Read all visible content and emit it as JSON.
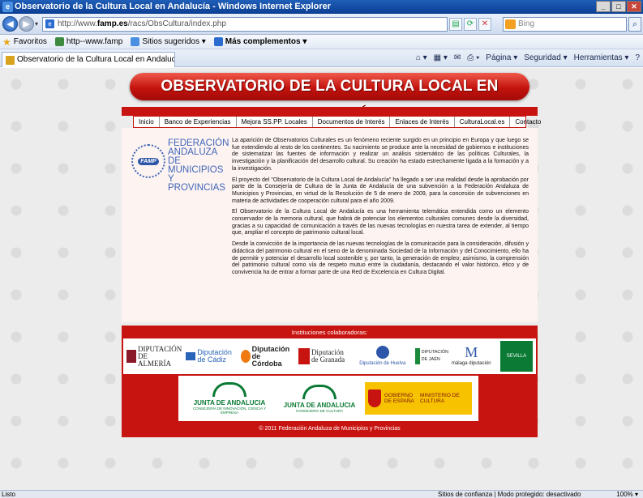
{
  "window": {
    "title": "Observatorio de la Cultura Local en Andalucía - Windows Internet Explorer"
  },
  "address": {
    "url_prefix": "http://www.",
    "url_domain": "famp.es",
    "url_rest": "/racs/ObsCultura/index.php",
    "search_placeholder": "Bing"
  },
  "favorites": {
    "label": "Favoritos",
    "items": [
      "http--www.famp",
      "Sitios sugeridos ▾",
      "Más complementos ▾"
    ]
  },
  "tab": {
    "label": "Observatorio de la Cultura Local en Andalucía"
  },
  "commandbar": {
    "pagina": "Página ▾",
    "seguridad": "Seguridad ▾",
    "herramientas": "Herramientas ▾"
  },
  "site": {
    "banner": "OBSERVATORIO DE LA CULTURA LOCAL EN ANDALUCÍA",
    "nav": [
      "Inicio",
      "Banco de Experiencias",
      "Mejora SS.PP. Locales",
      "Documentos de Interés",
      "Enlaces de Interés",
      "CulturaLocal.es",
      "Contacto"
    ],
    "fed_badge": "FAMP",
    "fed_lines": [
      "FEDERACIÓN",
      "ANDALUZA",
      "DE MUNICIPIOS",
      "Y PROVINCIAS"
    ],
    "paragraphs": [
      "La aparición de Observatorios Culturales es un fenómeno reciente surgido en un principio en Europa y que luego se fue extendiendo al resto de los continentes. Su nacimiento se produce ante la necesidad de gobiernos e instituciones de sistematizar las fuentes de información y realizar un análisis sistemático de las políticas Culturales, la investigación y la planificación del desarrollo cultural. Su creación ha estado estrechamente ligada a la formación y a la investigación.",
      "El proyecto del \"Observatorio de la Cultura Local de Andalucía\" ha llegado a ser una realidad desde la aprobación por parte de la Consejería de Cultura de la Junta de Andalucía de una subvención a la Federación Andaluza de Municipios y Provincias, en virtud de la Resolución de 5 de enero de 2009, para la concesión de subvenciones en materia de actividades de cooperación cultural para el año 2009.",
      "El Observatorio de la Cultura Local de Andalucía es una herramienta telemática entendida como un elemento conservador de la memoria cultural, que habrá de potenciar los elementos culturales comunes desde la diversidad, gracias a su capacidad de comunicación a través de las nuevas tecnologías en nuestra tarea de extender, al tiempo que, ampliar el concepto de patrimonio cultural local.",
      "Desde la convicción de la importancia de las nuevas tecnologías de la comunicación para la consideración, difusión y didáctica del patrimonio cultural en el seno de la denominada Sociedad de la Información y del Conocimiento, ello ha de permitir y potenciar el desarrollo local sostenible y, por tanto, la generación de empleo; asimismo, la comprensión del patrimonio cultural como vía de respeto mutuo entre la ciudadanía, destacando el valor histórico, ético y de convivencia ha de entrar a formar parte de una Red de Excelencia en Cultura Digital."
    ],
    "inst_title": "Instituciones colaboradoras:",
    "logos_row1": [
      "DIPUTACIÓN DE ALMERÍA",
      "Diputación de Cádiz",
      "Diputación de Córdoba",
      "Diputación de Granada",
      "Diputación de Huelva",
      "DIPUTACIÓN DE JAÉN",
      "málaga diputación",
      "SEVILLA"
    ],
    "junta1": {
      "title": "JUNTA DE ANDALUCIA",
      "sub": "CONSEJERÍA DE INNOVACIÓN, CIENCIA Y EMPRESA"
    },
    "junta2": {
      "title": "JUNTA DE ANDALUCIA",
      "sub": "CONSEJERÍA DE CULTURA"
    },
    "gob": {
      "left": "GOBIERNO DE ESPAÑA",
      "right": "MINISTERIO DE CULTURA"
    },
    "footer": "© 2011 Federación Andaluza de Municipios y Provincias"
  },
  "status": {
    "left": "Listo",
    "zone": "Sitios de confianza | Modo protegido: desactivado",
    "zoom": "100% ▾"
  }
}
